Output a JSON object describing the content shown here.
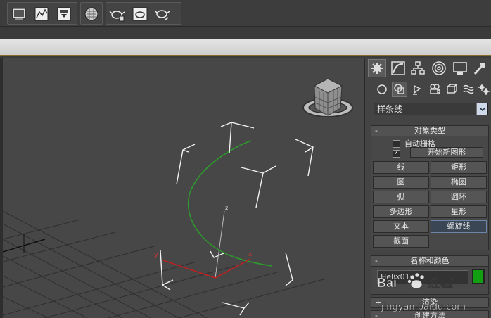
{
  "toolbar": {
    "buttons": [
      "render-setup-icon",
      "rendered-frame-window-icon",
      "render-to-texture-icon",
      "material-editor-icon",
      "teapot-render-icon",
      "teapot-production-icon",
      "teapot-activeshade-icon"
    ]
  },
  "panel": {
    "tabs": [
      "create-icon",
      "modify-icon",
      "hierarchy-icon",
      "motion-icon",
      "display-icon",
      "utilities-icon"
    ],
    "subtabs": [
      "geometry-icon",
      "shapes-icon",
      "lights-icon",
      "cameras-icon",
      "helpers-icon",
      "spacewarps-icon",
      "systems-icon"
    ],
    "category_dropdown": "样条线",
    "object_type": {
      "header": "对象类型",
      "autogrid_label": "自动栅格",
      "start_new_shape_label": "开始新图形",
      "start_new_shape_check": "✓",
      "buttons": [
        {
          "label": "线"
        },
        {
          "label": "矩形"
        },
        {
          "label": "圆"
        },
        {
          "label": "椭圆"
        },
        {
          "label": "弧"
        },
        {
          "label": "圆环"
        },
        {
          "label": "多边形"
        },
        {
          "label": "星形"
        },
        {
          "label": "文本"
        },
        {
          "label": "螺旋线",
          "active": true
        },
        {
          "label": "截面"
        }
      ]
    },
    "name_color": {
      "header": "名称和颜色",
      "name_value": "Helix01",
      "color": "#12a012"
    },
    "rollout3": {
      "header": "渲染",
      "sign": "+"
    },
    "rollout4": {
      "header": "创建方法",
      "sign": "-"
    },
    "collapse_sign": "-"
  },
  "watermark": {
    "logo_text": "Bai",
    "logo_text2": "经验",
    "url": "jingyan.baidu.com"
  },
  "viewport": {
    "axis_z": "z",
    "axis_y": "y",
    "axis_x": "x"
  }
}
